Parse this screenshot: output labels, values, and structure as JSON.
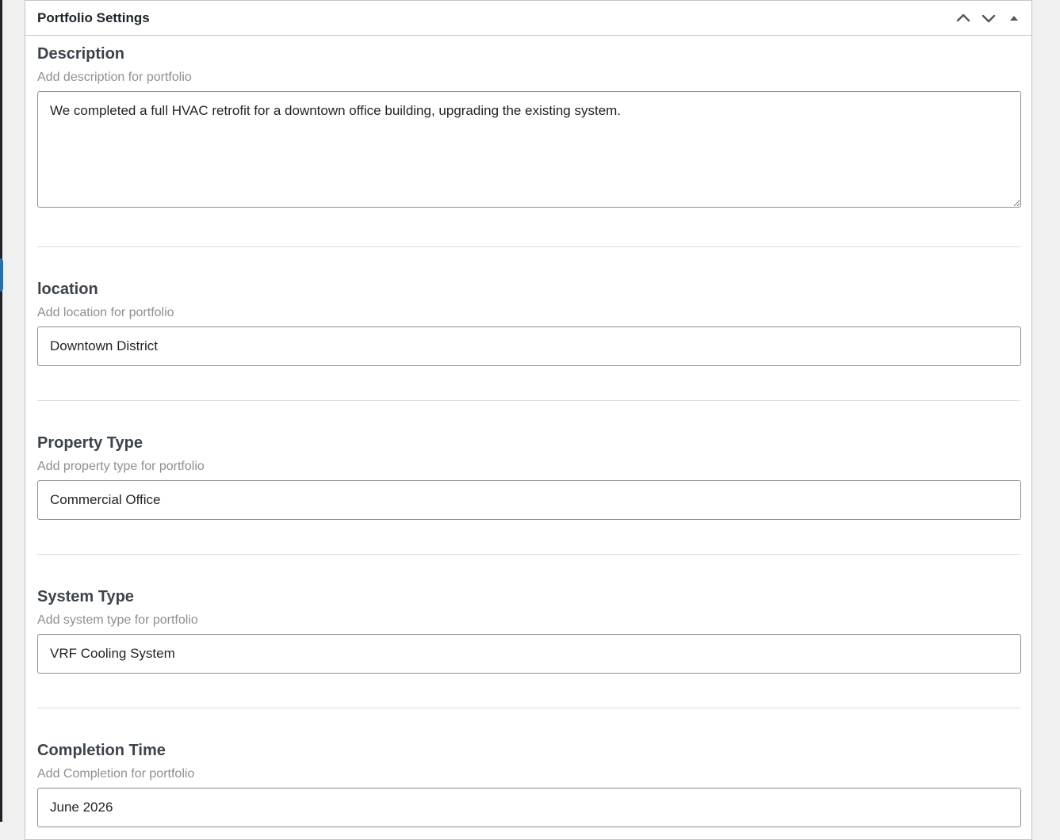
{
  "metabox": {
    "title": "Portfolio Settings",
    "actions": {
      "move_up": "chevron-up-icon",
      "move_down": "chevron-down-icon",
      "toggle": "triangle-up-icon"
    }
  },
  "fields": {
    "description": {
      "label": "Description",
      "help": "Add description for portfolio",
      "value": "We completed a full HVAC retrofit for a downtown office building, upgrading the existing system."
    },
    "location": {
      "label": "location",
      "help": "Add location for portfolio",
      "value": "Downtown District"
    },
    "property_type": {
      "label": "Property Type",
      "help": "Add property type for portfolio",
      "value": "Commercial Office"
    },
    "system_type": {
      "label": "System Type",
      "help": "Add system type for portfolio",
      "value": "VRF Cooling System"
    },
    "completion_time": {
      "label": "Completion Time",
      "help": "Add Completion for portfolio",
      "value": "June 2026"
    }
  },
  "colors": {
    "admin_accent": "#2271b1",
    "border": "#c3c4c7",
    "muted_text": "#8c8f94"
  }
}
